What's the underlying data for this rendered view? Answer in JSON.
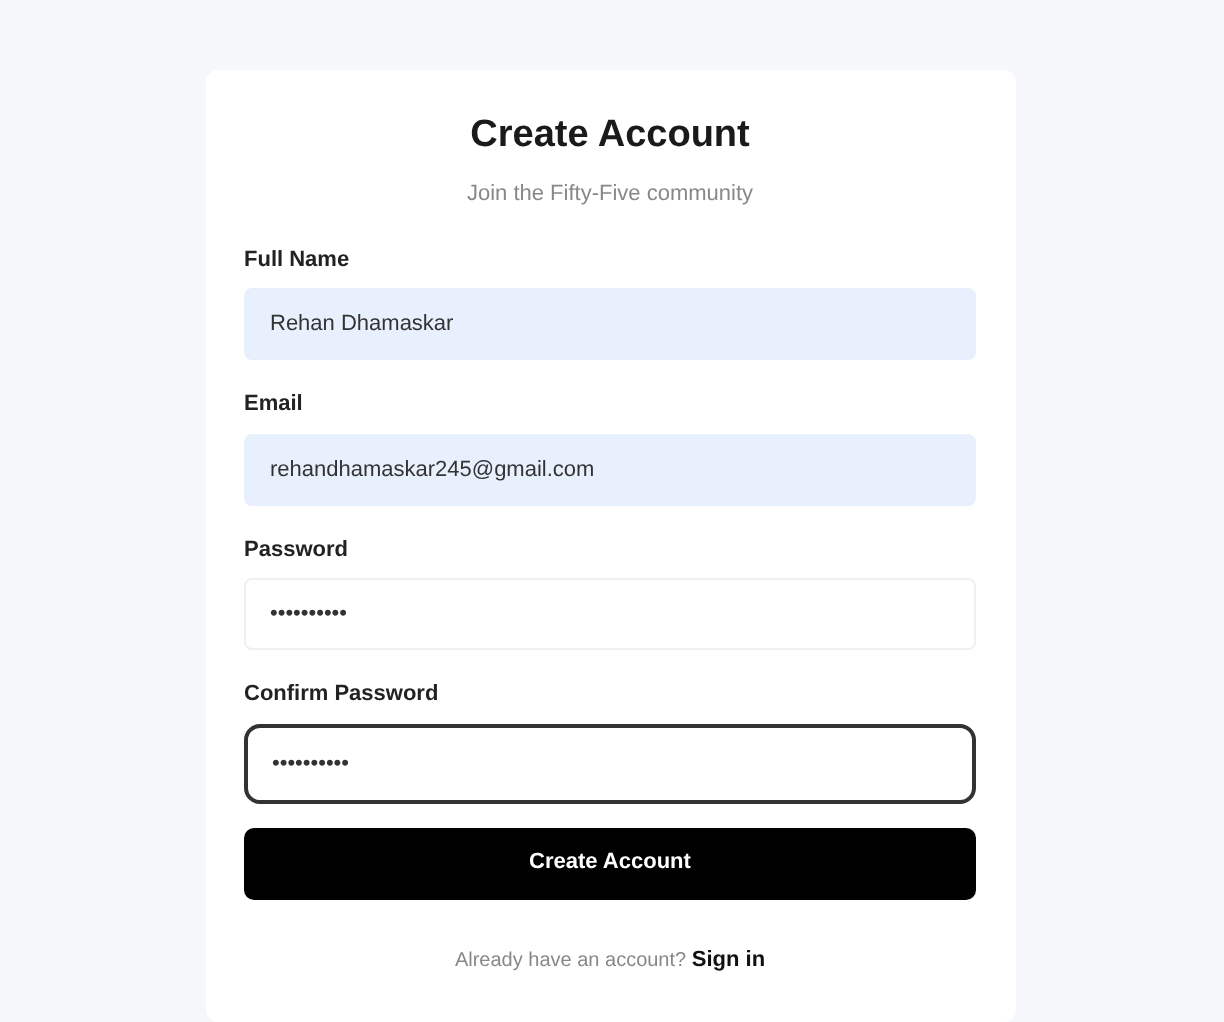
{
  "title": "Create Account",
  "subtitle": "Join the Fifty-Five community",
  "fields": [
    {
      "label": "Full Name",
      "value": "Rehan Dhamaskar",
      "autofilled": true,
      "focused": false
    },
    {
      "label": "Email",
      "value": "rehandhamaskar245@gmail.com",
      "autofilled": true,
      "focused": false
    },
    {
      "label": "Password",
      "value": "••••••••••",
      "autofilled": false,
      "focused": false
    },
    {
      "label": "Confirm Password",
      "value": "••••••••••",
      "autofilled": false,
      "focused": true
    }
  ],
  "submit": "Create Account",
  "footer": {
    "text": "Already have an account?",
    "link": "Sign in"
  }
}
